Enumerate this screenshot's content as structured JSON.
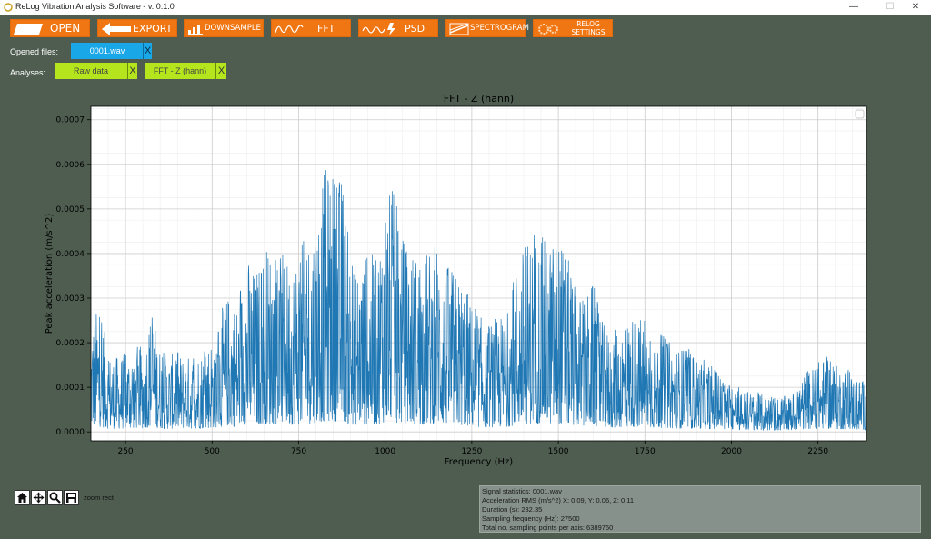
{
  "window": {
    "title": "ReLog Vibration Analysis Software - v. 0.1.0",
    "controls": {
      "minimize": "—",
      "maximize": "☐",
      "close": "✕"
    }
  },
  "toolbar": {
    "open": "OPEN",
    "export": "EXPORT",
    "downsample": "DOWNSAMPLE",
    "fft": "FFT",
    "psd": "PSD",
    "spectrogram": "SPECTROGRAM",
    "relog_settings_1": "RELOG",
    "relog_settings_2": "SETTINGS"
  },
  "files": {
    "label": "Opened files:",
    "items": [
      {
        "name": "0001.wav",
        "close": "X"
      }
    ]
  },
  "analyses": {
    "label": "Analyses:",
    "items": [
      {
        "name": "Raw data",
        "close": "X"
      },
      {
        "name": "FFT - Z (hann)",
        "close": "X"
      }
    ]
  },
  "colors": {
    "toolbar": "#f07613",
    "file_chip": "#1aa7e8",
    "analysis_chip": "#b5e61d",
    "line": "#1f77b4",
    "background": "#4e5d50"
  },
  "chart_data": {
    "type": "line",
    "title": "FFT - Z (hann)",
    "xlabel": "Frequency (Hz)",
    "ylabel": "Peak acceleration (m/s^2)",
    "xlim": [
      150,
      2390
    ],
    "ylim": [
      -2e-05,
      0.00073
    ],
    "xticks": [
      250,
      500,
      750,
      1000,
      1250,
      1500,
      1750,
      2000,
      2250
    ],
    "yticks": [
      "0.0000",
      "0.0001",
      "0.0002",
      "0.0003",
      "0.0004",
      "0.0005",
      "0.0006",
      "0.0007"
    ],
    "yticks_values": [
      0,
      0.0001,
      0.0002,
      0.0003,
      0.0004,
      0.0005,
      0.0006,
      0.0007
    ],
    "grid": "major and minor",
    "envelope": {
      "x": [
        150,
        175,
        200,
        225,
        250,
        275,
        300,
        325,
        350,
        375,
        400,
        425,
        450,
        475,
        500,
        525,
        550,
        575,
        600,
        625,
        650,
        675,
        700,
        725,
        750,
        775,
        800,
        825,
        850,
        875,
        900,
        925,
        950,
        975,
        1000,
        1025,
        1050,
        1075,
        1100,
        1125,
        1150,
        1175,
        1200,
        1225,
        1250,
        1275,
        1300,
        1325,
        1350,
        1375,
        1400,
        1425,
        1450,
        1475,
        1500,
        1525,
        1550,
        1575,
        1600,
        1625,
        1650,
        1675,
        1700,
        1725,
        1750,
        1775,
        1800,
        1825,
        1850,
        1875,
        1900,
        1925,
        1950,
        1975,
        2000,
        2025,
        2050,
        2075,
        2100,
        2125,
        2150,
        2175,
        2200,
        2225,
        2250,
        2275,
        2300,
        2325,
        2350,
        2375,
        2390
      ],
      "max": [
        0.00025,
        0.00029,
        0.00018,
        0.00017,
        0.00018,
        0.0002,
        0.00019,
        0.00028,
        0.00019,
        0.00017,
        0.00018,
        0.00017,
        0.00018,
        0.00019,
        0.00022,
        0.00027,
        0.00032,
        0.00029,
        0.0004,
        0.00036,
        0.00042,
        0.00043,
        0.0004,
        0.00039,
        0.00042,
        0.00044,
        0.00052,
        0.00059,
        0.0006,
        0.00058,
        0.0004,
        0.00038,
        0.00041,
        0.00039,
        0.00055,
        0.00054,
        0.00044,
        0.00042,
        0.0004,
        0.00041,
        0.00044,
        0.00038,
        0.00036,
        0.00035,
        0.00029,
        0.00026,
        0.00025,
        0.00026,
        0.00027,
        0.00037,
        0.00042,
        0.00045,
        0.00044,
        0.00043,
        0.00045,
        0.0004,
        0.00032,
        0.0003,
        0.00034,
        0.00025,
        0.00022,
        0.00024,
        0.00026,
        0.00027,
        0.00025,
        0.00021,
        0.00022,
        0.0002,
        0.00019,
        0.00019,
        0.00017,
        0.00016,
        0.00015,
        0.00012,
        0.00011,
        0.0001,
        9e-05,
        9e-05,
        8e-05,
        8e-05,
        8e-05,
        8e-05,
        0.00012,
        0.00014,
        0.00016,
        0.00017,
        0.00015,
        0.00015,
        0.00013,
        0.00012,
        0.00011
      ]
    }
  },
  "plot_toolbar": {
    "mode_label": "zoom rect"
  },
  "stats": {
    "line1": "Signal statistics: 0001.wav",
    "line2": "Acceleration RMS (m/s^2) X: 0.09, Y: 0.06, Z: 0.11",
    "line3": "Duration (s): 232.35",
    "line4": "Sampling frequency (Hz): 27500",
    "line5": "Total no. sampling points per axis: 6389760"
  }
}
